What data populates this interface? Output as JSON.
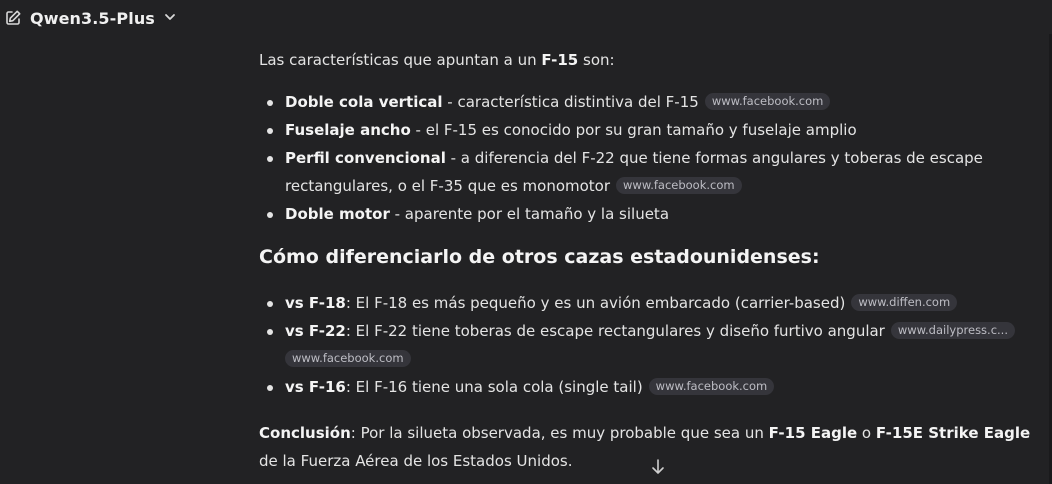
{
  "header": {
    "model_name": "Qwen3.5-Plus",
    "icons": [
      "edit-icon",
      "chevron-down-icon"
    ]
  },
  "content": {
    "intro": {
      "prefix": "Las características que apuntan a un ",
      "bold": "F-15",
      "suffix": " son:"
    },
    "features": [
      {
        "bold": "Doble cola vertical",
        "text": " - característica distintiva del F-15",
        "source": "www.facebook.com"
      },
      {
        "bold": "Fuselaje ancho",
        "text": " - el F-15 es conocido por su gran tamaño y fuselaje amplio"
      },
      {
        "bold": "Perfil convencional",
        "text": " - a diferencia del F-22 que tiene formas angulares y toberas de escape rectangulares, o el F-35 que es monomotor",
        "source": "www.facebook.com"
      },
      {
        "bold": "Doble motor",
        "text": " - aparente por el tamaño y la silueta"
      }
    ],
    "heading": "Cómo diferenciarlo de otros cazas estadounidenses:",
    "comparisons": [
      {
        "bold": "vs F-18",
        "text": ": El F-18 es más pequeño y es un avión embarcado (carrier-based)",
        "sources": [
          "www.diffen.com"
        ]
      },
      {
        "bold": "vs F-22",
        "text": ": El F-22 tiene toberas de escape rectangulares y diseño furtivo angular",
        "sources": [
          "www.dailypress.c...",
          "www.facebook.com"
        ]
      },
      {
        "bold": "vs F-16",
        "text": ": El F-16 tiene una sola cola (single tail)",
        "sources": [
          "www.facebook.com"
        ]
      }
    ],
    "conclusion": {
      "label": "Conclusión",
      "text1": ": Por la silueta observada, es muy probable que sea un ",
      "bold1": "F-15 Eagle",
      "text2": " o ",
      "bold2": "F-15E Strike Eagle",
      "text3": " de la Fuerza Aérea de los Estados Unidos."
    }
  },
  "scroll": {
    "icon": "arrow-down-icon"
  }
}
